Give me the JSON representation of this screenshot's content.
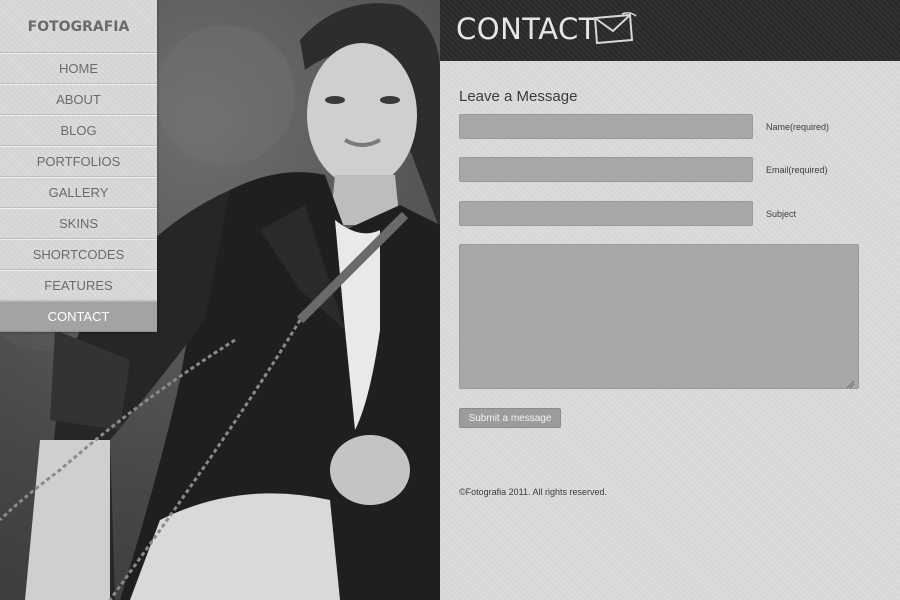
{
  "brand": {
    "logo_text": "FOTOGRAFIA"
  },
  "nav": {
    "items": [
      {
        "label": "HOME"
      },
      {
        "label": "ABOUT"
      },
      {
        "label": "BLOG"
      },
      {
        "label": "PORTFOLIOS"
      },
      {
        "label": "GALLERY"
      },
      {
        "label": "SKINS"
      },
      {
        "label": "SHORTCODES"
      },
      {
        "label": "FEATURES"
      },
      {
        "label": "CONTACT",
        "active": true
      }
    ]
  },
  "header": {
    "title": "CONTACT",
    "icon": "envelope-icon"
  },
  "form": {
    "heading": "Leave a Message",
    "name_label": "Name(required)",
    "name_value": "",
    "email_label": "Email(required)",
    "email_value": "",
    "subject_label": "Subject",
    "subject_value": "",
    "message_value": "",
    "submit_label": "Submit a message"
  },
  "footer": {
    "copyright": "©Fotografia 2011. All rights reserved."
  },
  "colors": {
    "header_bg": "#2b2b2b",
    "panel_bg": "#dadada",
    "field_bg": "#a8a8a8",
    "active_nav_bg": "#a3a3a3",
    "sidebar_bg": "#d8d8d8"
  }
}
